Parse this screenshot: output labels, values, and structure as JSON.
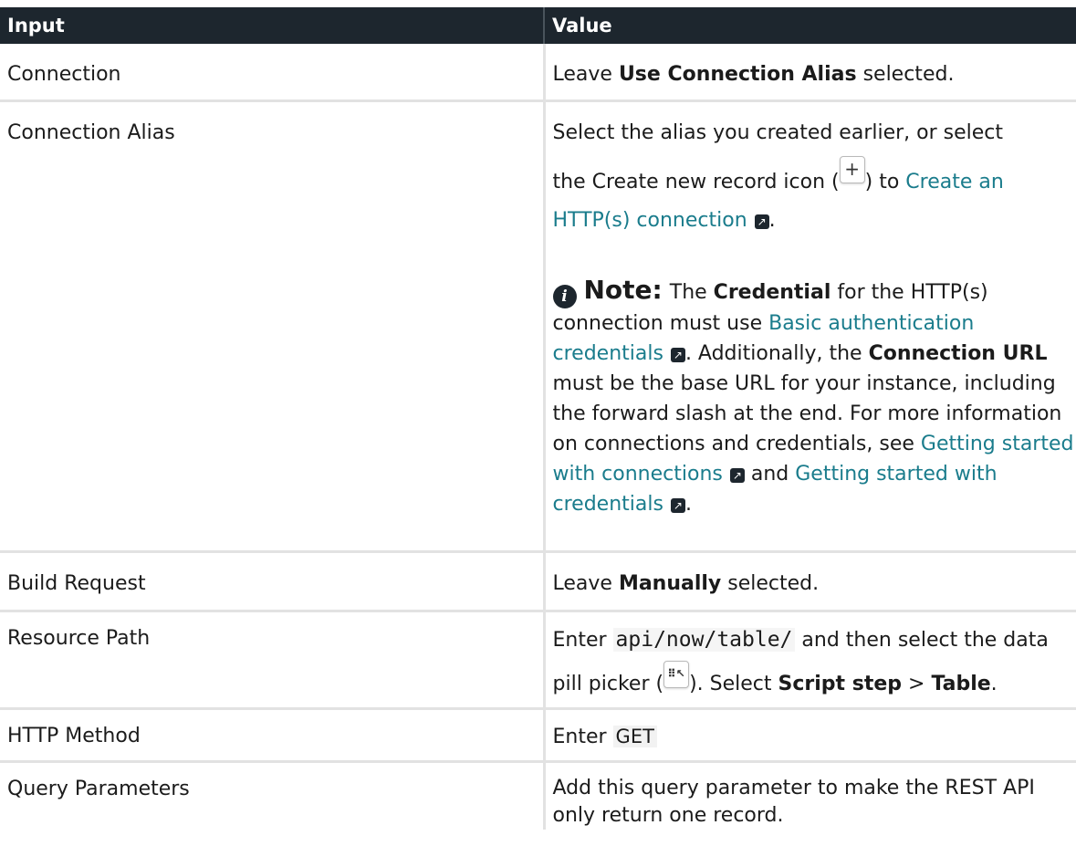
{
  "header": {
    "input": "Input",
    "value": "Value"
  },
  "rows": {
    "connection": {
      "input": "Connection",
      "pre": "Leave ",
      "bold": "Use Connection Alias",
      "post": " selected."
    },
    "alias": {
      "input": "Connection Alias",
      "line1": "Select the alias you created earlier, or select",
      "line2_pre": "the Create new record icon (",
      "plus_icon": "+",
      "line2_mid": ") to ",
      "link1": "Create an HTTP(s) connection",
      "link1_end": ".",
      "note": {
        "title": "Note:",
        "t1": "The ",
        "b1": "Credential",
        "t2": " for the HTTP(s) connection must use ",
        "link": "Basic authentication credentials",
        "t3": ". Additionally, the ",
        "b2": "Connection URL",
        "t4": " must be the base URL for your instance, including the forward slash at the end. For more information on connections and credentials, see ",
        "link2": "Getting started with connections",
        "t5": " and ",
        "link3": "Getting started with credentials",
        "t6": "."
      }
    },
    "build": {
      "input": "Build Request",
      "pre": "Leave ",
      "bold": "Manually",
      "post": " selected."
    },
    "resource": {
      "input": "Resource Path",
      "pre": "Enter ",
      "code": "api/now/table/",
      "mid": " and then select the data pill picker (",
      "post": "). Select ",
      "b1": "Script step",
      "gt": " > ",
      "b2": "Table",
      "end": "."
    },
    "http": {
      "input": "HTTP Method",
      "pre": "Enter ",
      "code": "GET"
    },
    "query": {
      "input": "Query Parameters",
      "text": "Add this query parameter to make the REST API only return one record."
    }
  },
  "icons": {
    "note": "info-icon",
    "external": "external-link-icon",
    "pill": "data-pill-picker-icon"
  },
  "colors": {
    "header_bg": "#1d262e",
    "link": "#1a7c8c",
    "border": "#e2e2e2"
  }
}
